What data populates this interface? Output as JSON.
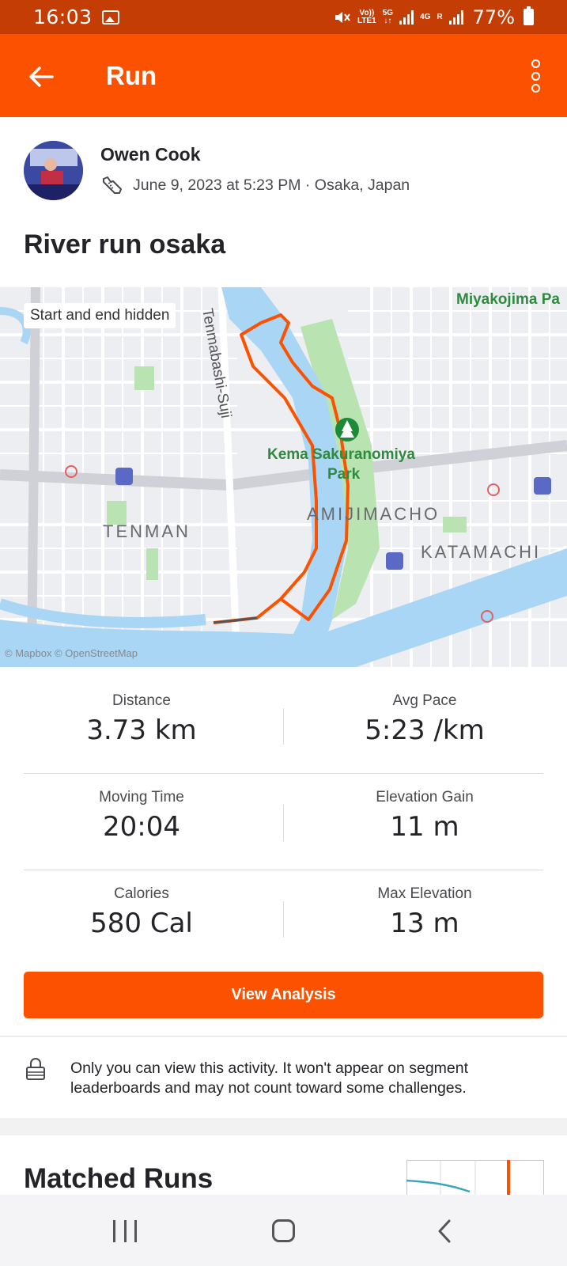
{
  "status_bar": {
    "time": "16:03",
    "volte": "Vo))",
    "lte": "LTE1",
    "net_5g": "5G",
    "net_4g": "4G",
    "roam": "R",
    "battery": "77%"
  },
  "app_bar": {
    "title": "Run",
    "icons": [
      "back-arrow-icon",
      "more-vertical-icon"
    ]
  },
  "activity": {
    "athlete_name": "Owen Cook",
    "meta": "June 9, 2023 at 5:23 PM · Osaka, Japan",
    "title": "River run osaka"
  },
  "map": {
    "overlay_label": "Start and end hidden",
    "credit": "© Mapbox © OpenStreetMap",
    "labels": {
      "miyakojima": "Miyakojima Pa",
      "tenmabashi": "Tenmabashi-Suji",
      "park_line1": "Kema Sakuranomiya",
      "park_line2": "Park",
      "amijimacho": "AMIJIMACHO",
      "tenman": "TENMAN",
      "katamachi": "KATAMACHI"
    },
    "route_color": "#fc5200"
  },
  "stats": [
    {
      "label": "Distance",
      "value": "3.73 km"
    },
    {
      "label": "Avg Pace",
      "value": "5:23 /km"
    },
    {
      "label": "Moving Time",
      "value": "20:04"
    },
    {
      "label": "Elevation Gain",
      "value": "11 m"
    },
    {
      "label": "Calories",
      "value": "580 Cal"
    },
    {
      "label": "Max Elevation",
      "value": "13 m"
    }
  ],
  "analysis_button": "View Analysis",
  "privacy_notice": "Only you can view this activity. It won't appear on segment leaderboards and may not count toward some challenges.",
  "matched_runs_title": "Matched Runs",
  "colors": {
    "brand_orange": "#fc5200",
    "status_bar": "#c43d05",
    "water": "#a9d6f5",
    "park": "#b9e3b0"
  }
}
